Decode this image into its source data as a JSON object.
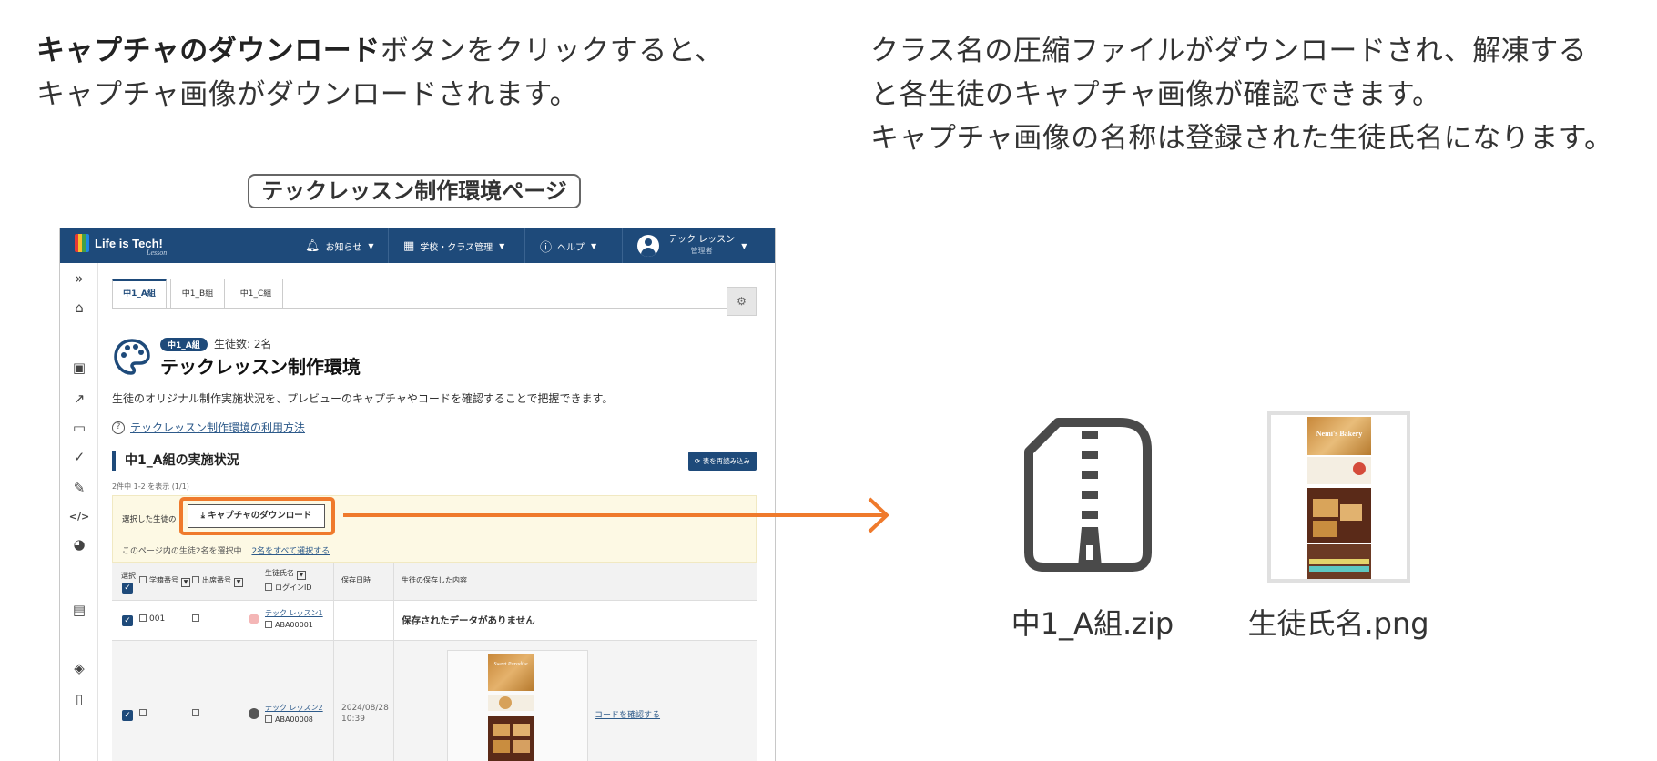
{
  "captions": {
    "left_bold": "キャプチャのダウンロード",
    "left_line1_rest": "ボタンをクリックすると、",
    "left_line2": "キャプチャ画像がダウンロードされます。",
    "right_line1": "クラス名の圧縮ファイルがダウンロードされ、解凍する",
    "right_line2": "と各生徒のキャプチャ画像が確認できます。",
    "right_line3": "キャプチャ画像の名称は登録された生徒氏名になります。"
  },
  "page_label": "テックレッスン制作環境ページ",
  "app": {
    "logo": "Life is Tech!",
    "logo_sub": "Lesson",
    "nav": {
      "notice": "お知らせ",
      "school": "学校・クラス管理",
      "help": "ヘルプ",
      "user_name": "テック レッスン",
      "user_role": "管理者"
    },
    "tabs": [
      "中1_A組",
      "中1_B組",
      "中1_C組"
    ],
    "badge": "中1_A組",
    "student_count": "生徒数: 2名",
    "title": "テックレッスン制作環境",
    "description": "生徒のオリジナル制作実施状況を、プレビューのキャプチャやコードを確認することで把握できます。",
    "howto_link": "テックレッスン制作環境の利用方法",
    "section_title": "中1_A組の実施状況",
    "reload_button": "表を再読み込み",
    "showing": "2件中 1-2 を表示 (1/1)",
    "selected_label": "選択した生徒の",
    "download_button": "キャプチャのダウンロード",
    "selected_info": "このページ内の生徒2名を選択中",
    "select_all_link": "2名をすべて選択する",
    "table": {
      "headers": {
        "select": "選択",
        "student_no": "学籍番号",
        "attendance_no": "出席番号",
        "name": "生徒氏名",
        "login_id": "ログインID",
        "saved_at": "保存日時",
        "content": "生徒の保存した内容"
      },
      "rows": [
        {
          "student_no": "001",
          "name": "テック レッスン1",
          "login_id": "ABA00001",
          "saved_at": "",
          "content": "保存されたデータがありません"
        },
        {
          "student_no": "",
          "name": "テック レッスン2",
          "login_id": "ABA00008",
          "saved_at": "2024/08/28 10:39",
          "content": "Sweet Paradise",
          "code_link": "コードを確認する"
        }
      ]
    }
  },
  "files": {
    "zip_name": "中1_A組.zip",
    "png_name": "生徒氏名.png",
    "png_thumb_title": "Nemi's Bakery"
  },
  "colors": {
    "navy": "#1e4a7a",
    "orange": "#ef7a2c",
    "zip_gray": "#4a4a4a"
  }
}
